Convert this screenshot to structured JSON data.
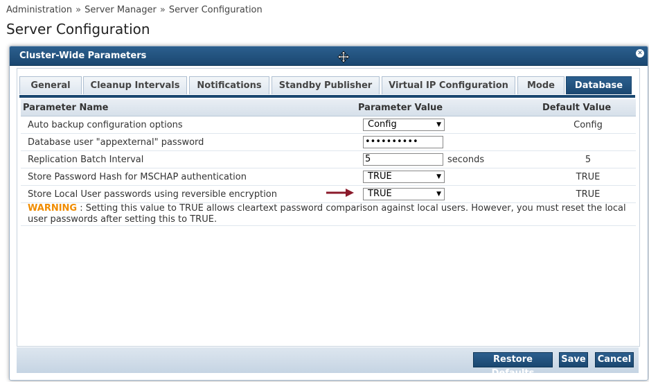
{
  "breadcrumb": [
    "Administration",
    "Server Manager",
    "Server Configuration"
  ],
  "breadcrumb_separator": "»",
  "page_title": "Server Configuration",
  "modal": {
    "title": "Cluster-Wide Parameters",
    "close_glyph": "✕"
  },
  "tabs": [
    {
      "label": "General",
      "active": false
    },
    {
      "label": "Cleanup Intervals",
      "active": false
    },
    {
      "label": "Notifications",
      "active": false
    },
    {
      "label": "Standby Publisher",
      "active": false
    },
    {
      "label": "Virtual IP Configuration",
      "active": false
    },
    {
      "label": "Mode",
      "active": false
    },
    {
      "label": "Database",
      "active": true
    }
  ],
  "table": {
    "headers": [
      "Parameter Name",
      "Parameter Value",
      "Default Value"
    ],
    "rows": [
      {
        "name": "Auto backup configuration options",
        "control": "select",
        "value": "Config",
        "default": "Config"
      },
      {
        "name": "Database user \"appexternal\" password",
        "control": "password",
        "value": "••••••••••",
        "default": ""
      },
      {
        "name": "Replication Batch Interval",
        "control": "text",
        "value": "5",
        "unit": "seconds",
        "default": "5"
      },
      {
        "name": "Store Password Hash for MSCHAP authentication",
        "control": "select",
        "value": "TRUE",
        "default": "TRUE"
      },
      {
        "name": "Store Local User passwords using reversible encryption",
        "control": "select",
        "value": "TRUE",
        "default": "TRUE",
        "highlighted": true
      }
    ],
    "warning_label": "WARNING",
    "warning_text": " : Setting this value to TRUE allows cleartext password comparison against local users. However, you must reset the local user passwords after setting this to TRUE."
  },
  "buttons": {
    "restore_defaults": "Restore Defaults",
    "save": "Save",
    "cancel": "Cancel"
  },
  "colors": {
    "header_blue": "#1a4770",
    "warning_orange": "#f08c00",
    "warning_text_blue": "#1d3fcc",
    "arrow_red": "#8b1a2b"
  },
  "icons": {
    "move": "move-icon",
    "close": "close-icon",
    "dropdown": "chevron-down-icon",
    "pointer_arrow": "arrow-right-icon"
  }
}
